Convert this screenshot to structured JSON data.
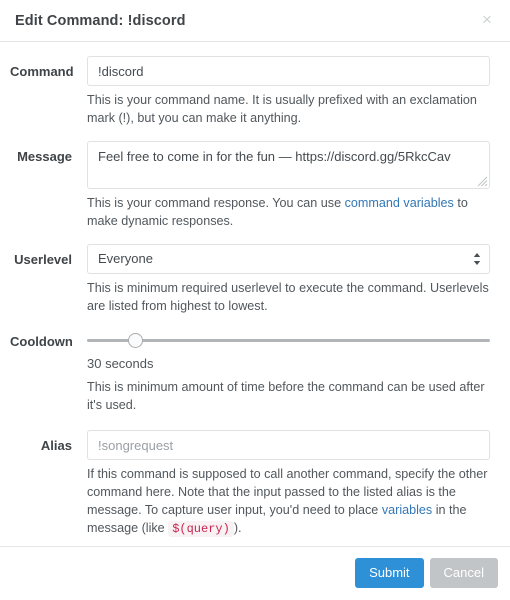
{
  "header": {
    "title": "Edit Command: !discord",
    "close_label": "×"
  },
  "fields": {
    "command": {
      "label": "Command",
      "value": "!discord",
      "placeholder": "",
      "help": "This is your command name. It is usually prefixed with an exclamation mark (!), but you can make it anything."
    },
    "message": {
      "label": "Message",
      "value": "Feel free to come in for the fun — https://discord.gg/5RkcCav",
      "placeholder": "",
      "help_before": "This is your command response. You can use ",
      "help_link": "command variables",
      "help_after": " to make dynamic responses."
    },
    "userlevel": {
      "label": "Userlevel",
      "selected": "Everyone",
      "options": [
        "Everyone"
      ],
      "help": "This is minimum required userlevel to execute the command. Userlevels are listed from highest to lowest."
    },
    "cooldown": {
      "label": "Cooldown",
      "value_text": "30 seconds",
      "percent": 12,
      "help": "This is minimum amount of time before the command can be used after it's used."
    },
    "alias": {
      "label": "Alias",
      "value": "",
      "placeholder": "!songrequest",
      "help_before": "If this command is supposed to call another command, specify the other command here. Note that the input passed to the listed alias is the message. To capture user input, you'd need to place ",
      "help_link": "variables",
      "help_mid": " in the message (like ",
      "help_code": "$(query)",
      "help_after": ")."
    }
  },
  "footer": {
    "submit_label": "Submit",
    "cancel_label": "Cancel"
  },
  "colors": {
    "primary": "#2e90d6",
    "secondary": "#c2c5c8",
    "link": "#3377b5",
    "code_text": "#c7254e",
    "code_bg": "#f9f2f4"
  }
}
